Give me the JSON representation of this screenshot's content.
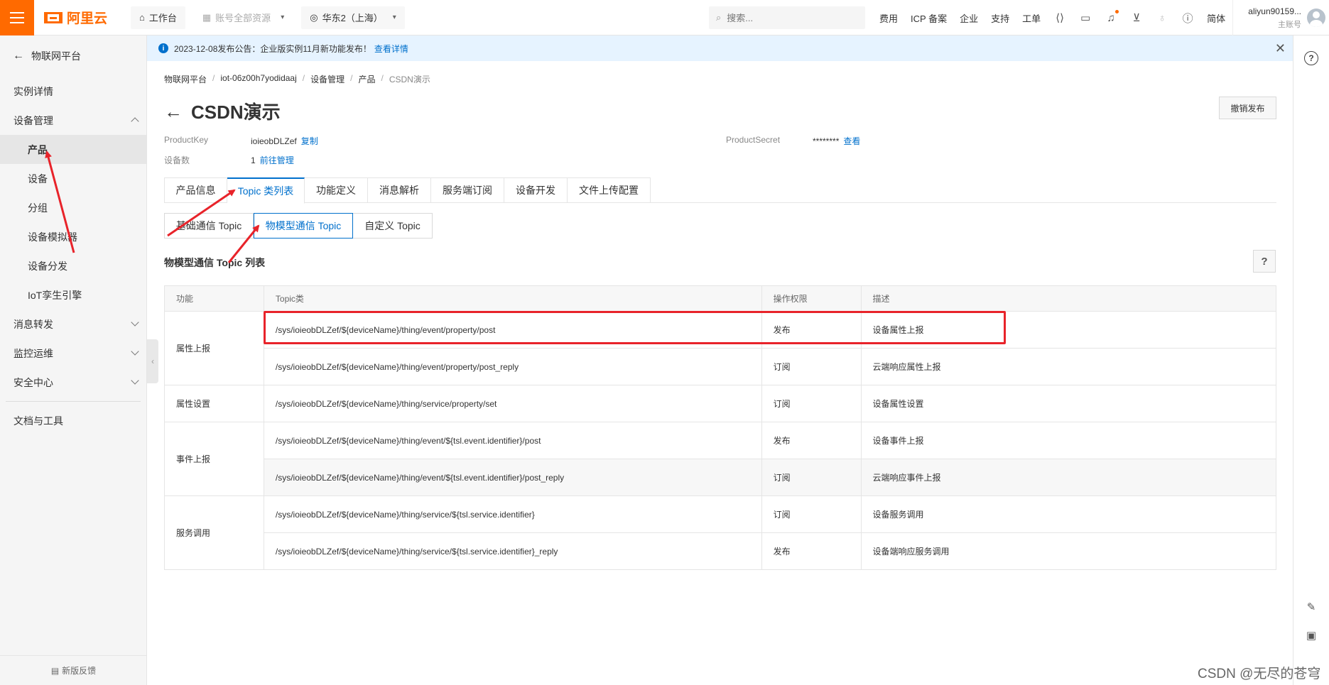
{
  "header": {
    "logo_text": "阿里云",
    "workbench_label": "工作台",
    "account_scope_label": "账号全部资源",
    "region_label": "华东2（上海）",
    "search_placeholder": "搜索...",
    "links": [
      "费用",
      "ICP 备案",
      "企业",
      "支持",
      "工单"
    ],
    "lang_label": "简体",
    "user_name": "aliyun90159...",
    "user_role": "主账号"
  },
  "sidebar": {
    "back_label": "物联网平台",
    "items": [
      {
        "label": "实例详情"
      },
      {
        "label": "设备管理"
      },
      {
        "label": "产品"
      },
      {
        "label": "设备"
      },
      {
        "label": "分组"
      },
      {
        "label": "设备模拟器"
      },
      {
        "label": "设备分发"
      },
      {
        "label": "IoT孪生引擎"
      },
      {
        "label": "消息转发"
      },
      {
        "label": "监控运维"
      },
      {
        "label": "安全中心"
      },
      {
        "label": "文档与工具"
      }
    ],
    "feedback_label": "新版反馈"
  },
  "notice": {
    "text": "2023-12-08发布公告：企业版实例11月新功能发布！",
    "link": "查看详情"
  },
  "breadcrumb": [
    "物联网平台",
    "iot-06z00h7yodidaaj",
    "设备管理",
    "产品",
    "CSDN演示"
  ],
  "product": {
    "title": "CSDN演示",
    "revoke_label": "撤销发布",
    "product_key_label": "ProductKey",
    "product_key": "ioieobDLZef",
    "copy_label": "复制",
    "product_secret_label": "ProductSecret",
    "product_secret": "********",
    "view_label": "查看",
    "device_count_label": "设备数",
    "device_count": "1",
    "manage_label": "前往管理"
  },
  "tabs": [
    "产品信息",
    "Topic 类列表",
    "功能定义",
    "消息解析",
    "服务端订阅",
    "设备开发",
    "文件上传配置"
  ],
  "subtabs": [
    "基础通信 Topic",
    "物模型通信 Topic",
    "自定义 Topic"
  ],
  "section_title": "物模型通信 Topic 列表",
  "table": {
    "headers": [
      "功能",
      "Topic类",
      "操作权限",
      "描述"
    ],
    "groups": [
      {
        "function": "属性上报",
        "rows": [
          {
            "topic": "/sys/ioieobDLZef/${deviceName}/thing/event/property/post",
            "perm": "发布",
            "desc": "设备属性上报"
          },
          {
            "topic": "/sys/ioieobDLZef/${deviceName}/thing/event/property/post_reply",
            "perm": "订阅",
            "desc": "云端响应属性上报"
          }
        ]
      },
      {
        "function": "属性设置",
        "rows": [
          {
            "topic": "/sys/ioieobDLZef/${deviceName}/thing/service/property/set",
            "perm": "订阅",
            "desc": "设备属性设置"
          }
        ]
      },
      {
        "function": "事件上报",
        "rows": [
          {
            "topic": "/sys/ioieobDLZef/${deviceName}/thing/event/${tsl.event.identifier}/post",
            "perm": "发布",
            "desc": "设备事件上报"
          },
          {
            "topic": "/sys/ioieobDLZef/${deviceName}/thing/event/${tsl.event.identifier}/post_reply",
            "perm": "订阅",
            "desc": "云端响应事件上报"
          }
        ]
      },
      {
        "function": "服务调用",
        "rows": [
          {
            "topic": "/sys/ioieobDLZef/${deviceName}/thing/service/${tsl.service.identifier}",
            "perm": "订阅",
            "desc": "设备服务调用"
          },
          {
            "topic": "/sys/ioieobDLZef/${deviceName}/thing/service/${tsl.service.identifier}_reply",
            "perm": "发布",
            "desc": "设备端响应服务调用"
          }
        ]
      }
    ]
  },
  "watermark": "CSDN @无尽的苍穹",
  "colors": {
    "brand": "#ff6a00",
    "link": "#0070cc",
    "annotation": "#e8232a"
  }
}
